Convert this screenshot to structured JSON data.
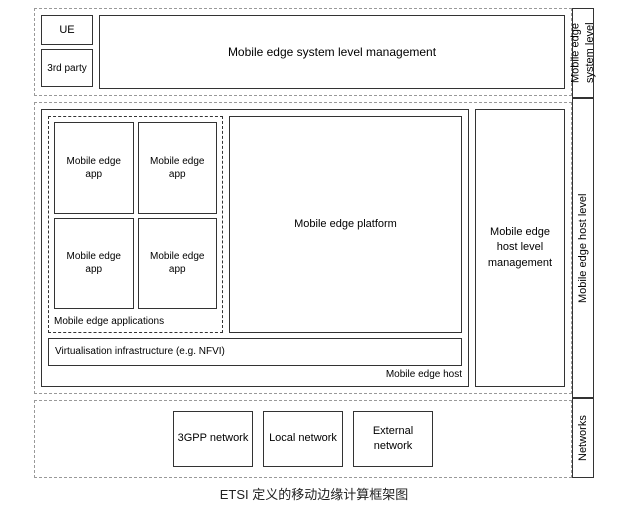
{
  "diagram": {
    "title": "ETSI 定义的移动边缘计算框架图",
    "labels": {
      "system_level": "Mobile edge system level",
      "host_level": "Mobile edge host level",
      "networks": "Networks"
    },
    "top": {
      "ue": "UE",
      "party": "3rd party",
      "management": "Mobile edge system level management"
    },
    "middle": {
      "apps": {
        "app1": "Mobile edge app",
        "app2": "Mobile edge app",
        "app3": "Mobile edge app",
        "app4": "Mobile edge app",
        "section_label": "Mobile edge applications"
      },
      "platform": "Mobile edge platform",
      "virtualisation": "Virtualisation infrastructure (e.g. NFVI)",
      "host_label": "Mobile edge host",
      "host_management": "Mobile edge host level management"
    },
    "bottom": {
      "network1": "3GPP network",
      "network2": "Local network",
      "network3": "External network"
    }
  }
}
